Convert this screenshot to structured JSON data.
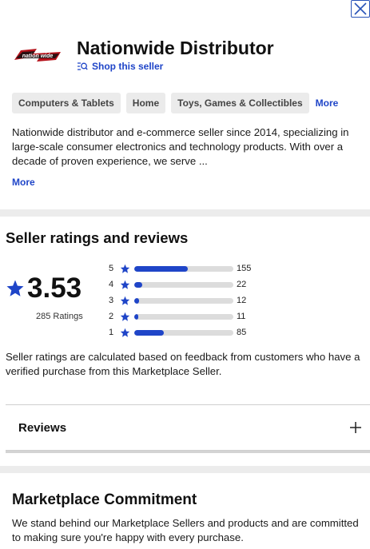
{
  "header": {
    "seller_name": "Nationwide Distributor",
    "shop_link": "Shop this seller",
    "logo_icon": "seller-logo"
  },
  "close_icon": "close-icon",
  "categories": {
    "chips": [
      "Computers & Tablets",
      "Home",
      "Toys, Games & Collectibles"
    ],
    "more_label": "More"
  },
  "description": {
    "text": "Nationwide distributor and e-commerce seller since 2014, specializing in large-scale consumer electronics and technology products. With over a decade of proven experience, we serve ...",
    "more_label": "More"
  },
  "ratings": {
    "title": "Seller ratings and reviews",
    "average": "3.53",
    "count_label": "285 Ratings",
    "breakdown": [
      {
        "stars": "5",
        "count": "155",
        "fraction": 0.54
      },
      {
        "stars": "4",
        "count": "22",
        "fraction": 0.08
      },
      {
        "stars": "3",
        "count": "12",
        "fraction": 0.05
      },
      {
        "stars": "2",
        "count": "11",
        "fraction": 0.04
      },
      {
        "stars": "1",
        "count": "85",
        "fraction": 0.3
      }
    ],
    "note": "Seller ratings are calculated based on feedback from customers who have a verified purchase from this Marketplace Seller.",
    "accent_color": "#1f45c8"
  },
  "reviews": {
    "label": "Reviews",
    "expand_icon": "plus-icon"
  },
  "commitment": {
    "title": "Marketplace Commitment",
    "text": "We stand behind our Marketplace Sellers and products and are committed to making sure you're happy with every purchase."
  }
}
